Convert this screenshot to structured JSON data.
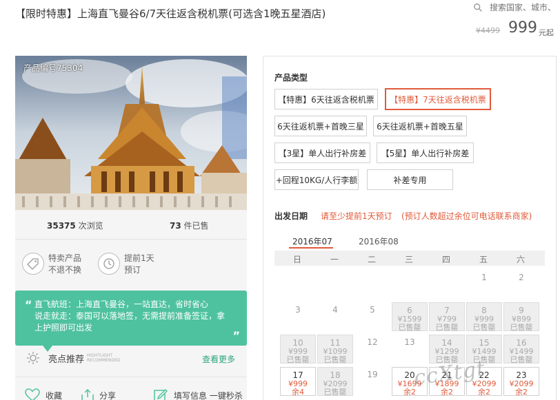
{
  "header": {
    "title": "【限时特惠】上海直飞曼谷6/7天往返含税机票(可选含1晚五星酒店)",
    "search_placeholder": "搜索国家、城市、",
    "price_old": "¥4499",
    "price": "999",
    "price_unit": "元起"
  },
  "left": {
    "product_no": "产品编号75304",
    "views_num": "35375",
    "views_label": "次浏览",
    "sold_num": "73",
    "sold_label": "件已售",
    "features": [
      {
        "line1": "特卖产品",
        "line2": "不退不换",
        "icon": "tag-icon"
      },
      {
        "line1": "提前1天",
        "line2": "预订",
        "icon": "clock-icon"
      }
    ],
    "quote_lines": [
      "直飞航班：上海直飞曼谷，一站直达，省时省心",
      "说走就走：泰国可以落地签，无需提前准备签证，拿",
      "上护照即可出发"
    ],
    "highlight_label": "亮点推荐",
    "highlight_en1": "HIGHTLIGHT",
    "highlight_en2": "RECOMMENDED",
    "more_label": "查看更多",
    "actions": [
      {
        "label": "收藏",
        "icon": "heart-icon"
      },
      {
        "label": "分享",
        "icon": "share-icon"
      },
      {
        "label": "填写信息 一键秒杀",
        "icon": "edit-icon"
      }
    ]
  },
  "right": {
    "type_label": "产品类型",
    "options": [
      "【特惠】6天往返含税机票",
      "【特惠】7天往返含税机票",
      "6天往返机票+首晚三星",
      "6天往返机票+首晚五星",
      "【3星】单人出行补房差",
      "【5星】单人出行补房差",
      "+回程10KG/人行李额",
      "补差专用"
    ],
    "selected_option": 1,
    "date_label": "出发日期",
    "date_note1": "请至少提前1天预订",
    "date_note2": "(预订人数超过余位可电话联系商家)",
    "months": [
      "2016年07",
      "2016年08"
    ],
    "weekdays": [
      "日",
      "一",
      "二",
      "三",
      "四",
      "五",
      "六"
    ],
    "days": [
      {
        "d": "1"
      },
      {
        "d": "2"
      },
      {
        "d": "3"
      },
      {
        "d": "4"
      },
      {
        "d": "5"
      },
      {
        "d": "6",
        "p": "¥1599",
        "s": "已售罄"
      },
      {
        "d": "7",
        "p": "¥799",
        "s": "已售罄"
      },
      {
        "d": "8",
        "p": "¥999",
        "s": "已售罄"
      },
      {
        "d": "9",
        "p": "¥899",
        "s": "已售罄"
      },
      {
        "d": "10",
        "p": "¥999",
        "s": "已售罄"
      },
      {
        "d": "11",
        "p": "¥1099",
        "s": "已售罄"
      },
      {
        "d": "12"
      },
      {
        "d": "13"
      },
      {
        "d": "14",
        "p": "¥1299",
        "s": "已售罄"
      },
      {
        "d": "15",
        "p": "¥1499",
        "s": "已售罄"
      },
      {
        "d": "16",
        "p": "¥1499",
        "s": "已售罄"
      },
      {
        "d": "17",
        "p": "¥999",
        "s": "余4"
      },
      {
        "d": "18",
        "p": "¥2099",
        "s": "已售罄"
      },
      {
        "d": "19"
      },
      {
        "d": "20",
        "p": "¥1699",
        "s": "余2"
      },
      {
        "d": "21",
        "p": "¥1899",
        "s": "余2"
      },
      {
        "d": "22",
        "p": "¥2099",
        "s": "余2"
      },
      {
        "d": "23",
        "p": "¥2099",
        "s": "余2"
      }
    ],
    "watermark": "ccXtgt"
  }
}
